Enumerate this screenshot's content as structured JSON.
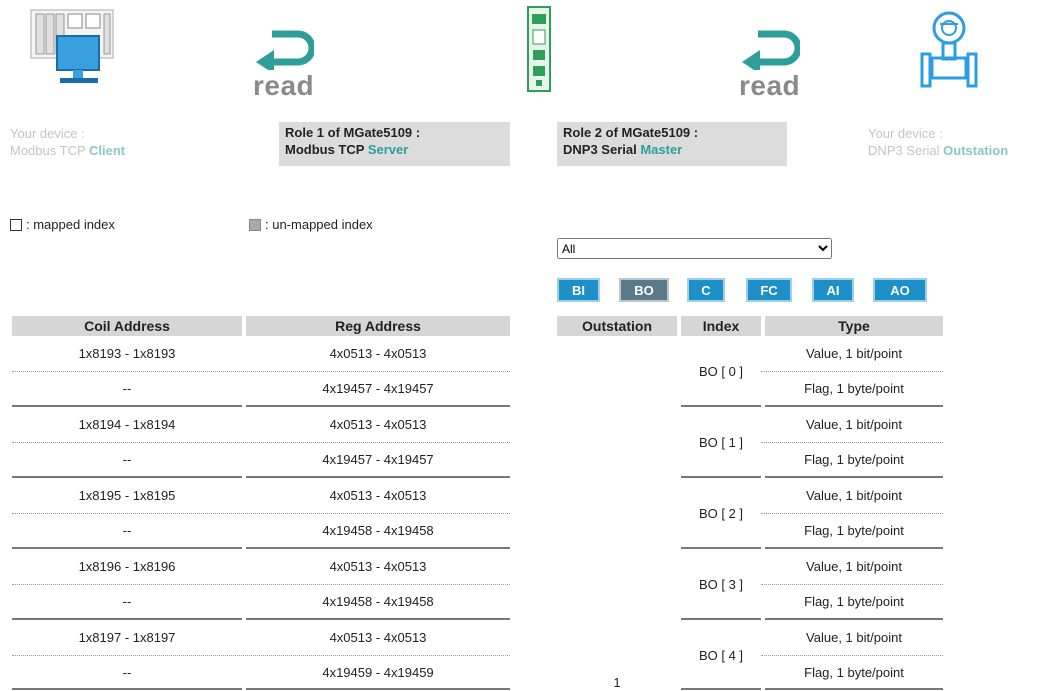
{
  "diagram": {
    "read_left": "read",
    "read_right": "read",
    "client_label_line1": "Your device :",
    "client_label_line2a": "Modbus TCP ",
    "client_label_line2b": "Client",
    "role1_line1": "Role 1 of MGate5109 :",
    "role1_line2a": "Modbus TCP ",
    "role1_line2b": "Server",
    "role2_line1": "Role 2 of MGate5109 :",
    "role2_line2a": "DNP3 Serial ",
    "role2_line2b": "Master",
    "outstation_label_line1": "Your device :",
    "outstation_label_line2a": "DNP3 Serial ",
    "outstation_label_line2b": "Outstation"
  },
  "legend": {
    "mapped": ": mapped index",
    "unmapped": ": un-mapped index"
  },
  "filter": {
    "selected": "All",
    "options": [
      "All"
    ]
  },
  "type_tabs": [
    "BI",
    "BO",
    "C",
    "FC",
    "AI",
    "AO"
  ],
  "active_tab": "BO",
  "left_table": {
    "headers": [
      "Coil Address",
      "Reg Address"
    ],
    "rows": [
      {
        "coil": "1x8193 - 1x8193",
        "reg": "4x0513 - 4x0513"
      },
      {
        "coil": "--",
        "reg": "4x19457 - 4x19457"
      },
      {
        "coil": "1x8194 - 1x8194",
        "reg": "4x0513 - 4x0513"
      },
      {
        "coil": "--",
        "reg": "4x19457 - 4x19457"
      },
      {
        "coil": "1x8195 - 1x8195",
        "reg": "4x0513 - 4x0513"
      },
      {
        "coil": "--",
        "reg": "4x19458 - 4x19458"
      },
      {
        "coil": "1x8196 - 1x8196",
        "reg": "4x0513 - 4x0513"
      },
      {
        "coil": "--",
        "reg": "4x19458 - 4x19458"
      },
      {
        "coil": "1x8197 - 1x8197",
        "reg": "4x0513 - 4x0513"
      },
      {
        "coil": "--",
        "reg": "4x19459 - 4x19459"
      }
    ]
  },
  "right_table": {
    "headers": [
      "Outstation",
      "Index",
      "Type"
    ],
    "outstation_value": "1",
    "groups": [
      {
        "index": "BO [ 0 ]",
        "types": [
          "Value, 1 bit/point",
          "Flag, 1 byte/point"
        ]
      },
      {
        "index": "BO [ 1 ]",
        "types": [
          "Value, 1 bit/point",
          "Flag, 1 byte/point"
        ]
      },
      {
        "index": "BO [ 2 ]",
        "types": [
          "Value, 1 bit/point",
          "Flag, 1 byte/point"
        ]
      },
      {
        "index": "BO [ 3 ]",
        "types": [
          "Value, 1 bit/point",
          "Flag, 1 byte/point"
        ]
      },
      {
        "index": "BO [ 4 ]",
        "types": [
          "Value, 1 bit/point",
          "Flag, 1 byte/point"
        ]
      }
    ]
  },
  "colors": {
    "accent_teal": "#2e9e9a",
    "tab_blue": "#1e90c8",
    "tab_active": "#5a7a8c",
    "header_gray": "#d6d6d6",
    "unmapped_gray": "#b0a8a8"
  },
  "icons": [
    "plc-computer-icon",
    "read-arrow-icon",
    "mgate-gateway-icon",
    "read-arrow-icon",
    "flow-meter-icon"
  ]
}
